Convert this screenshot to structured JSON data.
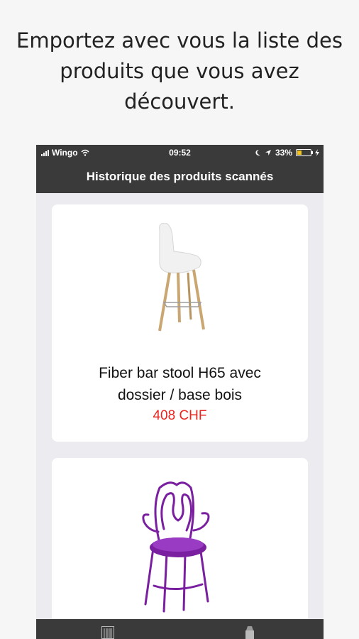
{
  "promo": {
    "line1": "Emportez avec vous la liste des",
    "line2": "produits que vous avez",
    "line3": "découvert."
  },
  "status_bar": {
    "carrier": "Wingo",
    "time": "09:52",
    "battery_percent": "33%",
    "battery_level": 0.33
  },
  "nav": {
    "title": "Historique des produits scannés"
  },
  "products": [
    {
      "name_line1": "Fiber bar stool H65 avec",
      "name_line2": "dossier / base bois",
      "price": "408 CHF",
      "image_icon": "bar-stool-image"
    },
    {
      "image_icon": "purple-iron-chair-image"
    }
  ],
  "tabbar": {
    "items": [
      {
        "icon": "barcode-icon"
      },
      {
        "icon": "history-icon"
      }
    ]
  },
  "colors": {
    "bar_dark": "#3a3a3a",
    "price_red": "#e8251f",
    "chair_purple": "#7a1fa0",
    "background": "#f6f6f6",
    "list_background": "#ebebf0"
  }
}
